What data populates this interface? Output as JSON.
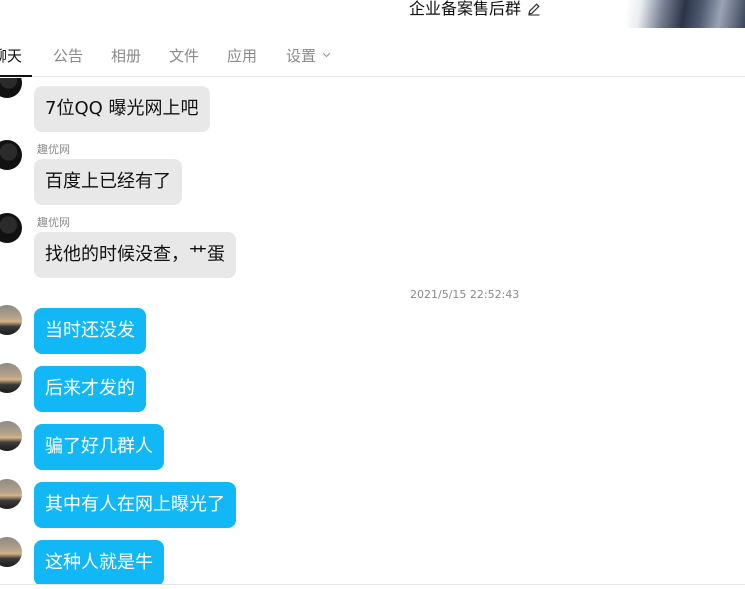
{
  "header": {
    "group_title": "企业备案售后群"
  },
  "tabs": [
    {
      "label": "聊天",
      "active": true
    },
    {
      "label": "公告"
    },
    {
      "label": "相册"
    },
    {
      "label": "文件"
    },
    {
      "label": "应用"
    },
    {
      "label": "设置"
    }
  ],
  "messages": [
    {
      "sender": "",
      "text": "7位QQ 曝光网上吧",
      "style": "gray"
    },
    {
      "sender": "趣优网",
      "text": "百度上已经有了",
      "style": "gray"
    },
    {
      "sender": "趣优网",
      "text": "找他的时候没查，艹蛋",
      "style": "gray"
    },
    {
      "timestamp": "2021/5/15 22:52:43"
    },
    {
      "text": "当时还没发",
      "style": "blue"
    },
    {
      "text": "后来才发的",
      "style": "blue"
    },
    {
      "text": "骗了好几群人",
      "style": "blue"
    },
    {
      "text": "其中有人在网上曝光了",
      "style": "blue"
    },
    {
      "text": "这种人就是牛",
      "style": "blue"
    }
  ],
  "colors": {
    "outgoing_bubble": "#12b7f5",
    "incoming_bubble": "#e8e8e8",
    "active_tab": "#111111",
    "inactive_tab": "#8a8a8a"
  },
  "icons": {
    "edit": "pencil-icon",
    "settings_dropdown": "chevron-down-icon"
  }
}
